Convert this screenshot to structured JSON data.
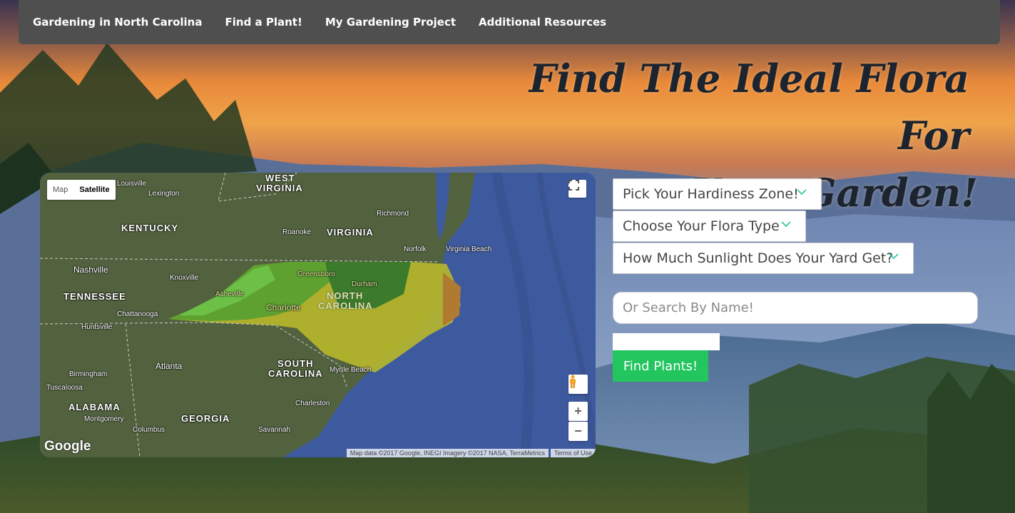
{
  "nav": {
    "links": [
      "Gardening in North Carolina",
      "Find a Plant!",
      "My Gardening Project",
      "Additional Resources"
    ]
  },
  "hero": {
    "line1": "Find The Ideal Flora For",
    "line2": "Your Garden!"
  },
  "map": {
    "type_map": "Map",
    "type_satellite": "Satellite",
    "labels": {
      "west_virginia_1": "WEST",
      "west_virginia_2": "VIRGINIA",
      "kentucky": "KENTUCKY",
      "virginia": "VIRGINIA",
      "tennessee": "TENNESSEE",
      "north_carolina_1": "NORTH",
      "north_carolina_2": "CAROLINA",
      "south_carolina_1": "SOUTH",
      "south_carolina_2": "CAROLINA",
      "alabama": "ALABAMA",
      "georgia": "GEORGIA",
      "louisville": "Louisville",
      "lexington": "Lexington",
      "richmond": "Richmond",
      "roanoke": "Roanoke",
      "norfolk": "Norfolk",
      "virginia_beach": "Virginia Beach",
      "nashville": "Nashville",
      "knoxville": "Knoxville",
      "greensboro": "Greensboro",
      "durham": "Durham",
      "asheville": "Asheville",
      "charlotte": "Charlotte",
      "chattanooga": "Chattanooga",
      "huntsville": "Huntsville",
      "atlanta": "Atlanta",
      "birmingham": "Birmingham",
      "tuscaloosa": "Tuscaloosa",
      "myrtle_beach": "Myrtle Beach",
      "charleston": "Charleston",
      "montgomery": "Montgomery",
      "columbus": "Columbus",
      "savannah": "Savannah"
    },
    "logo": "Google",
    "attribution": "Map data ©2017 Google, INEGI Imagery ©2017 NASA, TerraMetrics",
    "terms": "Terms of Use",
    "zoom_in": "+",
    "zoom_out": "−"
  },
  "form": {
    "hardiness_zone": "Pick Your Hardiness Zone!",
    "flora_type": "Choose Your Flora Type",
    "sunlight": "How Much Sunlight Does Your Yard Get?",
    "search_placeholder": "Or Search By Name!",
    "submit": "Find Plants!"
  },
  "colors": {
    "navbar": "#4f4f4f",
    "accent_chevron": "#26c6a8",
    "button": "#22c55e",
    "title": "#1c2430"
  },
  "icons": {
    "dropdown": "chevron-down-icon",
    "fullscreen": "fullscreen-icon",
    "pegman": "pegman-icon"
  }
}
